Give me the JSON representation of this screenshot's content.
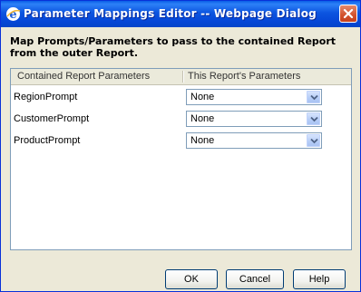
{
  "window": {
    "title": "Parameter Mappings Editor -- Webpage Dialog",
    "icon": "ie-icon",
    "close_icon": "close-icon"
  },
  "instructions": "Map Prompts/Parameters to pass to the contained Report from the outer Report.",
  "grid": {
    "headers": [
      "Contained Report Parameters",
      "This Report's Parameters"
    ],
    "rows": [
      {
        "label": "RegionPrompt",
        "value": "None"
      },
      {
        "label": "CustomerPrompt",
        "value": "None"
      },
      {
        "label": "ProductPrompt",
        "value": "None"
      }
    ]
  },
  "buttons": {
    "ok": "OK",
    "cancel": "Cancel",
    "help": "Help"
  },
  "colors": {
    "titlebar": "#0546d6",
    "dialog_bg": "#ece9d8",
    "close_button": "#d2522d",
    "border": "#7f9db9"
  }
}
